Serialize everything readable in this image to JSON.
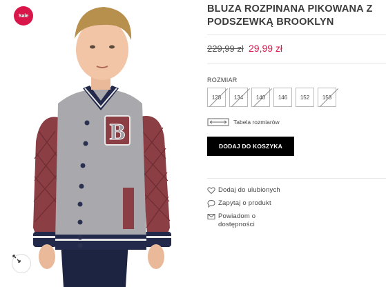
{
  "badge": {
    "label": "Sale"
  },
  "product": {
    "title": "BLUZA ROZPINANA PIKOWANA Z PODSZEWKĄ BROOKLYN",
    "price_old": "229,99 zł",
    "price_new": "29,99 zł"
  },
  "sizes": {
    "label": "ROZMIAR",
    "options": [
      {
        "value": "128",
        "available": false
      },
      {
        "value": "134",
        "available": false
      },
      {
        "value": "140",
        "available": false
      },
      {
        "value": "146",
        "available": true
      },
      {
        "value": "152",
        "available": true
      },
      {
        "value": "158",
        "available": false
      }
    ]
  },
  "size_table": {
    "label": "Tabela rozmiarów"
  },
  "cart": {
    "button_label": "DODAJ DO KOSZYKA"
  },
  "actions": {
    "wishlist": "Dodaj do ulubionych",
    "ask": "Zapytaj o produkt",
    "notify": "Powiadom o dostępności"
  },
  "colors": {
    "accent": "#d8164a",
    "jacket_body": "#a9a9ad",
    "sleeve": "#8b3e44",
    "button_bg": "#000000"
  },
  "image": {
    "letter": "B"
  }
}
